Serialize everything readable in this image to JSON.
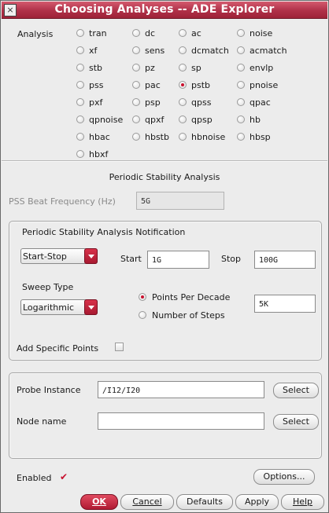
{
  "window": {
    "title": "Choosing Analyses -- ADE Explorer"
  },
  "analysis": {
    "label": "Analysis",
    "selected": "pstb",
    "options": [
      "tran",
      "dc",
      "ac",
      "noise",
      "xf",
      "sens",
      "dcmatch",
      "acmatch",
      "stb",
      "pz",
      "sp",
      "envlp",
      "pss",
      "pac",
      "pstb",
      "pnoise",
      "pxf",
      "psp",
      "qpss",
      "qpac",
      "qpnoise",
      "qpxf",
      "qpsp",
      "hb",
      "hbac",
      "hbstb",
      "hbnoise",
      "hbsp",
      "hbxf"
    ]
  },
  "section_title": "Periodic Stability Analysis",
  "beat_frequency": {
    "label": "PSS Beat Frequency (Hz)",
    "value": "5G"
  },
  "notification": {
    "title": "Periodic Stability Analysis Notification",
    "range_type": "Start-Stop",
    "start_label": "Start",
    "start_value": "1G",
    "stop_label": "Stop",
    "stop_value": "100G",
    "sweep_type_label": "Sweep Type",
    "sweep_type": "Logarithmic",
    "points_per_decade_label": "Points Per Decade",
    "number_of_steps_label": "Number of Steps",
    "step_mode_selected": "points_per_decade",
    "points_value": "5K",
    "add_points_label": "Add Specific Points",
    "add_points_checked": false
  },
  "probe": {
    "instance_label": "Probe Instance",
    "instance_value": "/I12/I20",
    "node_label": "Node name",
    "node_value": "",
    "select_label": "Select"
  },
  "footer": {
    "enabled_label": "Enabled",
    "enabled_checked": true,
    "options_label": "Options...",
    "ok_label": "OK",
    "cancel_label": "Cancel",
    "defaults_label": "Defaults",
    "apply_label": "Apply",
    "help_label": "Help"
  },
  "colors": {
    "accent": "#b03048",
    "radio_dot": "#c8102e"
  }
}
